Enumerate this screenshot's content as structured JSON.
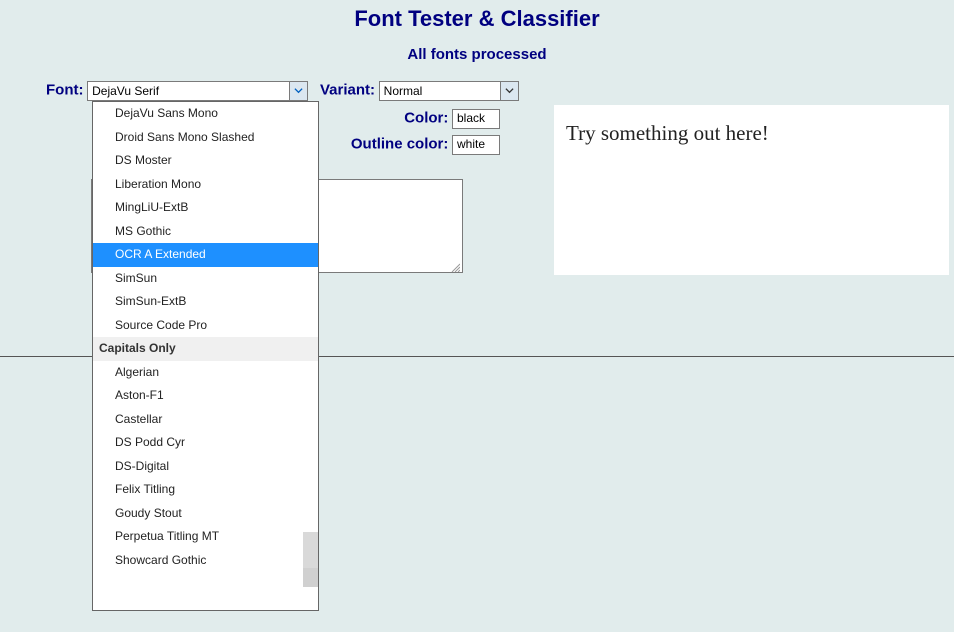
{
  "title": "Font Tester & Classifier",
  "status": "All fonts processed",
  "labels": {
    "font": "Font:",
    "variant": "Variant:",
    "color": "Color:",
    "outline_color": "Outline color:"
  },
  "font_select": {
    "value": "DejaVu Serif",
    "highlighted": "OCR A Extended",
    "items": [
      {
        "type": "item",
        "label": "DejaVu Sans Mono"
      },
      {
        "type": "item",
        "label": "Droid Sans Mono Slashed"
      },
      {
        "type": "item",
        "label": "DS Moster"
      },
      {
        "type": "item",
        "label": "Liberation Mono"
      },
      {
        "type": "item",
        "label": "MingLiU-ExtB"
      },
      {
        "type": "item",
        "label": "MS Gothic"
      },
      {
        "type": "item",
        "label": "OCR A Extended"
      },
      {
        "type": "item",
        "label": "SimSun"
      },
      {
        "type": "item",
        "label": "SimSun-ExtB"
      },
      {
        "type": "item",
        "label": "Source Code Pro"
      },
      {
        "type": "group",
        "label": "Capitals Only"
      },
      {
        "type": "item",
        "label": "Algerian"
      },
      {
        "type": "item",
        "label": "Aston-F1"
      },
      {
        "type": "item",
        "label": "Castellar"
      },
      {
        "type": "item",
        "label": "DS Podd Cyr"
      },
      {
        "type": "item",
        "label": "DS-Digital"
      },
      {
        "type": "item",
        "label": "Felix Titling"
      },
      {
        "type": "item",
        "label": "Goudy Stout"
      },
      {
        "type": "item",
        "label": "Perpetua Titling MT"
      },
      {
        "type": "item",
        "label": "Showcard Gothic"
      }
    ]
  },
  "variant_select": {
    "value": "Normal"
  },
  "color_input": {
    "value": "black"
  },
  "outline_input": {
    "value": "white"
  },
  "preview_text": "Try something out here!"
}
